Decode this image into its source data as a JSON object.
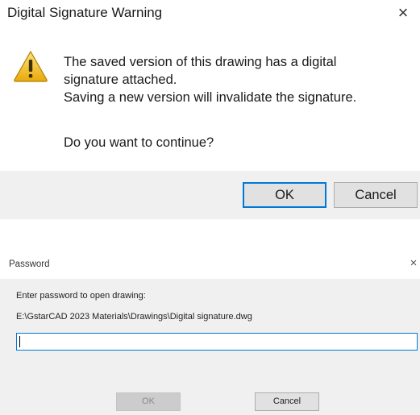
{
  "warning_dialog": {
    "title": "Digital Signature Warning",
    "close_glyph": "×",
    "icon": "warning-triangle-icon",
    "icon_color": "#f5c518",
    "message_lines": [
      "The saved version of this drawing has a digital",
      "signature attached.",
      "Saving a new version will invalidate the signature."
    ],
    "question": "Do you want to continue?",
    "buttons": {
      "ok": "OK",
      "cancel": "Cancel"
    },
    "accent_color": "#0078d7"
  },
  "password_dialog": {
    "title": "Password",
    "close_glyph": "×",
    "prompt": "Enter password to open drawing:",
    "file_path": "E:\\GstarCAD 2023 Materials\\Drawings\\Digital signature.dwg",
    "password_value": "",
    "buttons": {
      "ok": "OK",
      "ok_enabled": false,
      "cancel": "Cancel"
    }
  }
}
